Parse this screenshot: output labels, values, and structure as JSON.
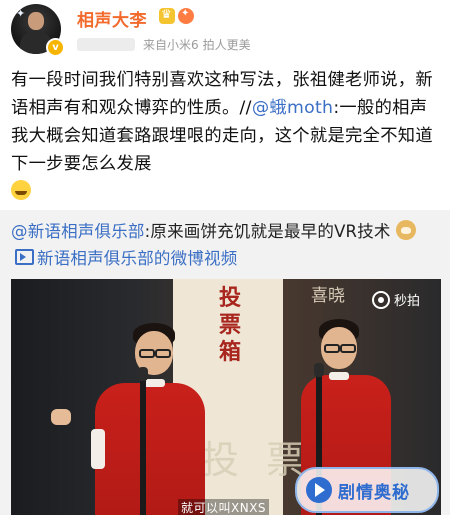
{
  "post": {
    "username": "相声大李",
    "meta": {
      "source": "来自小米6",
      "extra": "拍人更美"
    },
    "text_parts": [
      "有一段时间我们特别喜欢这种写法，张祖健老师说，新语相声有和观众博弈的性质。//",
      "@蛾moth",
      ":一般的相声我大概会知道套路跟埋哏的走向，这个就是完全不知道下一步要怎么发展"
    ],
    "icons": [
      "cry-emoji"
    ]
  },
  "repost": {
    "mention": "@新语相声俱乐部",
    "text": ":原来画饼充饥就是最早的VR技术",
    "video_link": "新语相声俱乐部的微博视频",
    "icons": [
      "doge-emoji",
      "video-icon"
    ]
  },
  "video": {
    "banner_text": "投票箱",
    "back_text": "喜晓",
    "logo_text": "秒拍",
    "subtitle": "就可以叫XNXS",
    "watermark_text": "剧情奥秘",
    "faded_chars": [
      "投",
      "票"
    ]
  },
  "colors": {
    "username": "#f26b2d",
    "link": "#3b6fc5",
    "repost_bg": "#f2f2f2",
    "robe": "#c9201a",
    "watermark": "#2f6cd0"
  }
}
